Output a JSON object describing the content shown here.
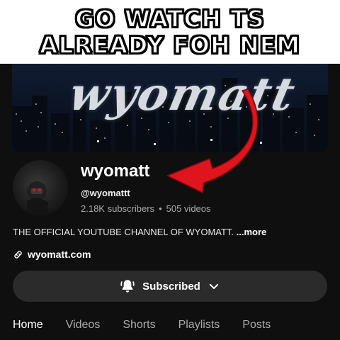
{
  "caption": {
    "line1": "GO WATCH TS",
    "line2": "ALREADY FOH NEM"
  },
  "banner": {
    "logo_text": "wyomatt"
  },
  "channel": {
    "name": "wyomatt",
    "handle": "@wyomattt",
    "subscribers": "2.18K subscribers",
    "separator": "•",
    "videos": "505 videos",
    "description": "THE OFFICIAL YOUTUBE CHANNEL OF WYOMATT.",
    "more_label": "...more",
    "link": "wyomatt.com"
  },
  "subscribe_button": {
    "label": "Subscribed",
    "bell_icon": "bell-icon",
    "chevron_icon": "chevron-down-icon"
  },
  "tabs": [
    {
      "label": "Home",
      "active": true
    },
    {
      "label": "Videos",
      "active": false
    },
    {
      "label": "Shorts",
      "active": false
    },
    {
      "label": "Playlists",
      "active": false
    },
    {
      "label": "Posts",
      "active": false
    }
  ],
  "colors": {
    "background": "#0f0f0f",
    "arrow": "#e0141c",
    "button_bg": "#2b2b2b",
    "muted_text": "#aaaaaa"
  }
}
